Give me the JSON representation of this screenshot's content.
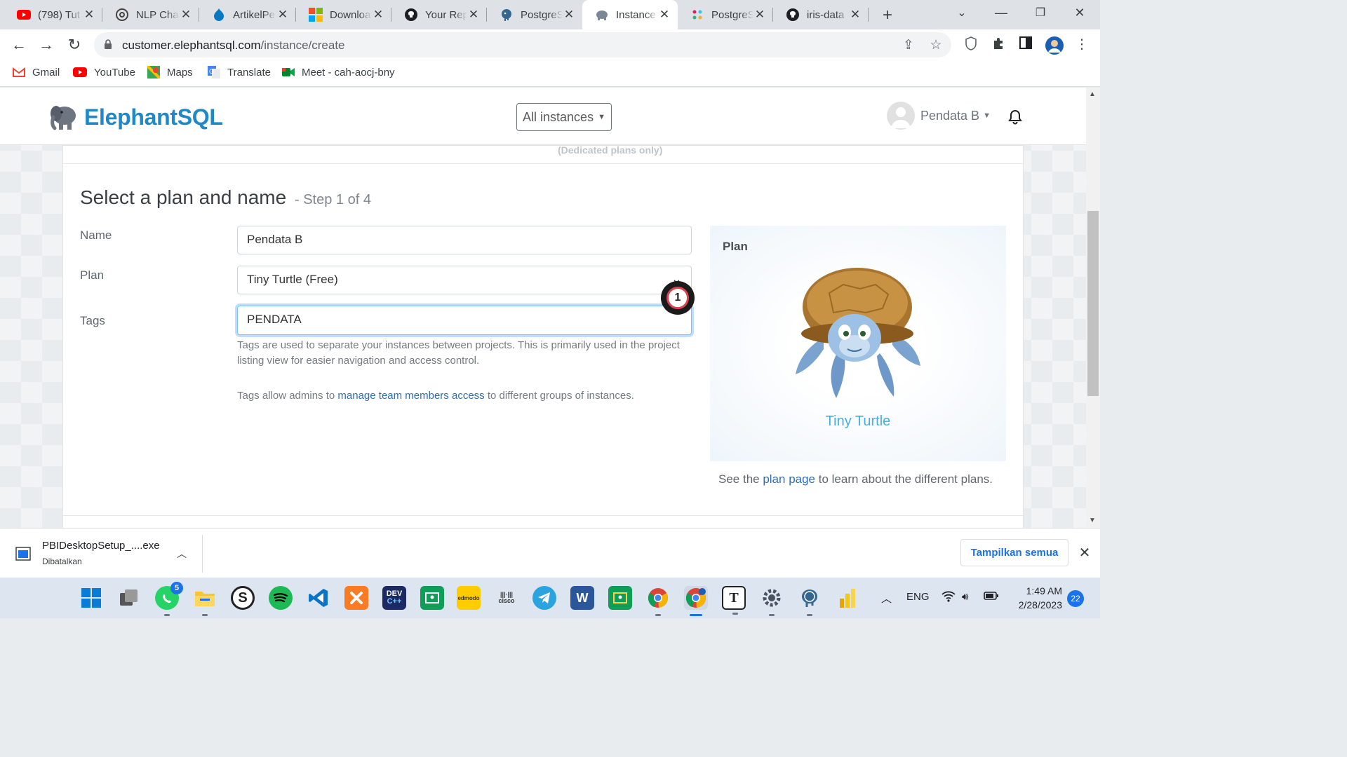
{
  "browser": {
    "tabs": [
      {
        "title": "(798) Tut",
        "icon": "youtube-icon"
      },
      {
        "title": "NLP Chat",
        "icon": "chatgpt-icon"
      },
      {
        "title": "ArtikelPe",
        "icon": "drupal-icon"
      },
      {
        "title": "Downloa",
        "icon": "microsoft-icon"
      },
      {
        "title": "Your Rep",
        "icon": "github-icon"
      },
      {
        "title": "PostgreS",
        "icon": "postgres-icon"
      },
      {
        "title": "Instance",
        "icon": "elephantsql-icon",
        "active": true
      },
      {
        "title": "PostgreS",
        "icon": "slack-icon"
      },
      {
        "title": "iris-data",
        "icon": "github-icon"
      }
    ],
    "url_domain": "customer.elephantsql.com",
    "url_path": "/instance/create",
    "bookmarks": [
      {
        "label": "Gmail",
        "icon": "gmail-icon"
      },
      {
        "label": "YouTube",
        "icon": "youtube-icon"
      },
      {
        "label": "Maps",
        "icon": "maps-icon"
      },
      {
        "label": "Translate",
        "icon": "translate-icon"
      },
      {
        "label": "Meet - cah-aocj-bny",
        "icon": "meet-icon"
      }
    ]
  },
  "app": {
    "brand": "ElephantSQL",
    "instances_button": "All instances",
    "user_name": "Pendata B",
    "top_note": "(Dedicated plans only)"
  },
  "form": {
    "title": "Select a plan and name",
    "step": "- Step 1 of 4",
    "name_label": "Name",
    "name_value": "Pendata B",
    "plan_label": "Plan",
    "plan_value": "Tiny Turtle (Free)",
    "tags_label": "Tags",
    "tags_value": "PENDATA",
    "tags_help": "Tags are used to separate your instances between projects. This is primarily used in the project listing view for easier navigation and access control.",
    "admin_help_prefix": "Tags allow admins to ",
    "admin_help_link": "manage team members access",
    "admin_help_suffix": " to different groups of instances.",
    "badge_number": "1"
  },
  "plan_panel": {
    "title": "Plan",
    "plan_name": "Tiny Turtle",
    "note_prefix": "See the ",
    "note_link": "plan page",
    "note_suffix": " to learn about the different plans."
  },
  "downloads": {
    "file_name": "PBIDesktopSetup_....exe",
    "file_status": "Dibatalkan",
    "show_all": "Tampilkan semua"
  },
  "taskbar": {
    "whatsapp_badge": "5",
    "language": "ENG",
    "time": "1:49 AM",
    "date": "2/28/2023",
    "notification_count": "22"
  }
}
